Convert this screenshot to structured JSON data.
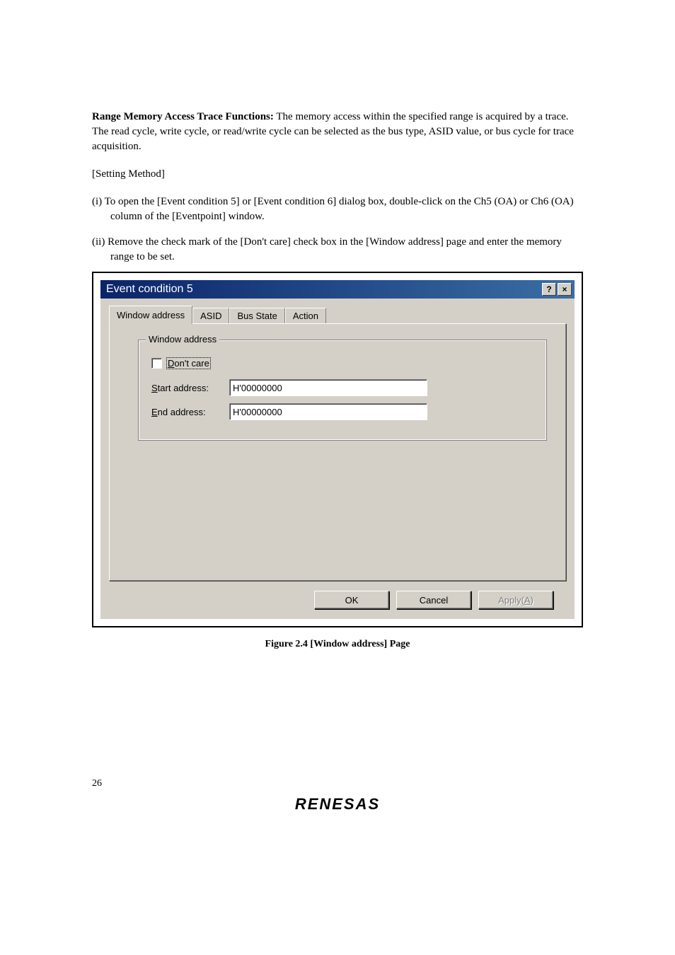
{
  "heading_bold": "Range Memory Access Trace Functions:",
  "heading_rest": "  The memory access within the specified range is acquired by a trace. The read cycle, write cycle, or read/write cycle can be selected as the bus type, ASID value, or bus cycle for trace acquisition.",
  "setting_method": "[Setting Method]",
  "list": {
    "i": "(i)  To open the [Event condition 5] or [Event condition 6] dialog box, double-click on the Ch5 (OA) or Ch6 (OA) column of the [Eventpoint] window.",
    "ii": "(ii) Remove the check mark of the [Don't care] check box in the [Window address] page and enter the memory range to be set."
  },
  "dialog": {
    "title": "Event condition 5",
    "help_btn": "?",
    "close_btn": "×",
    "tabs": {
      "window_address": "Window address",
      "asid": "ASID",
      "bus_state": "Bus State",
      "action": "Action"
    },
    "groupbox_legend": "Window address",
    "dont_care_prefix": "D",
    "dont_care_rest": "on't care",
    "start_prefix": "S",
    "start_rest": "tart address:",
    "start_value": "H'00000000",
    "end_prefix": "E",
    "end_rest": "nd address:",
    "end_value": "H'00000000",
    "ok": "OK",
    "cancel": "Cancel",
    "apply_prefix": "Apply(",
    "apply_access": "A",
    "apply_suffix": ")"
  },
  "figure_caption": "Figure 2.4   [Window address] Page",
  "page_number": "26",
  "logo": "RENESAS"
}
